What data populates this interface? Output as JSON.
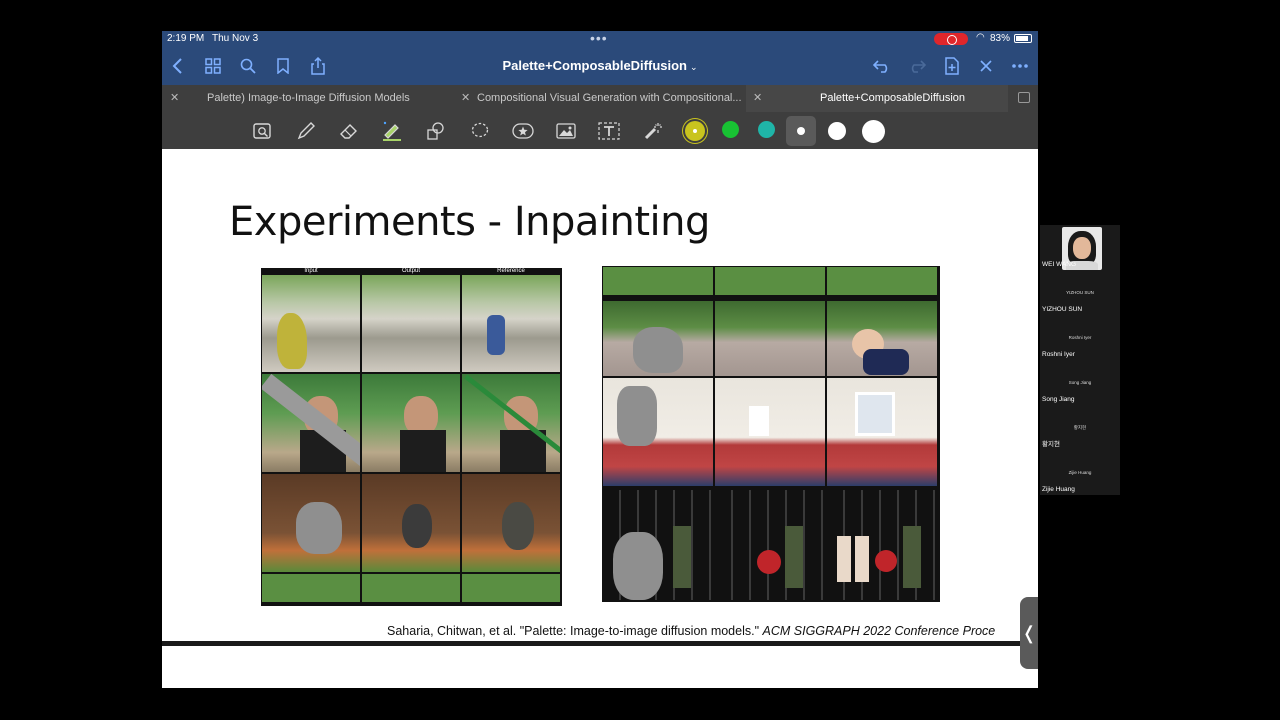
{
  "status_bar": {
    "time": "2:19 PM",
    "date": "Thu Nov 3",
    "battery": "83%"
  },
  "navbar": {
    "title": "Palette+ComposableDiffusion",
    "caret": "⌄"
  },
  "tabs": [
    {
      "label": "Palette) Image-to-Image Diffusion Models"
    },
    {
      "label": "Compositional Visual Generation with Compositional..."
    },
    {
      "label": "Palette+ComposableDiffusion"
    }
  ],
  "colors": {
    "accent": "#7fb0ff",
    "bar": "#2b4a7a",
    "swatches": [
      "#c9c41e",
      "#18c233",
      "#1fb5a8",
      "#ffffff",
      "#ffffff",
      "#ffffff"
    ]
  },
  "slide": {
    "title": "Experiments - Inpainting",
    "left_figure": {
      "columns": [
        "Input",
        "Output",
        "Reference"
      ]
    },
    "citation_plain": "Saharia, Chitwan, et al. \"Palette: Image-to-image diffusion models.\" ",
    "citation_italic": "ACM SIGGRAPH 2022 Conference Proce"
  },
  "participants": [
    {
      "name": "WEI WANG",
      "center": ""
    },
    {
      "name": "YIZHOU SUN",
      "center": "YIZHOU SUN"
    },
    {
      "name": "Roshni Iyer",
      "center": "Roshni Iyer"
    },
    {
      "name": "Song Jiang",
      "center": "Song Jiang"
    },
    {
      "name": "황지현",
      "center": "황지현"
    },
    {
      "name": "Zijie Huang",
      "center": "Zijie Huang"
    }
  ]
}
